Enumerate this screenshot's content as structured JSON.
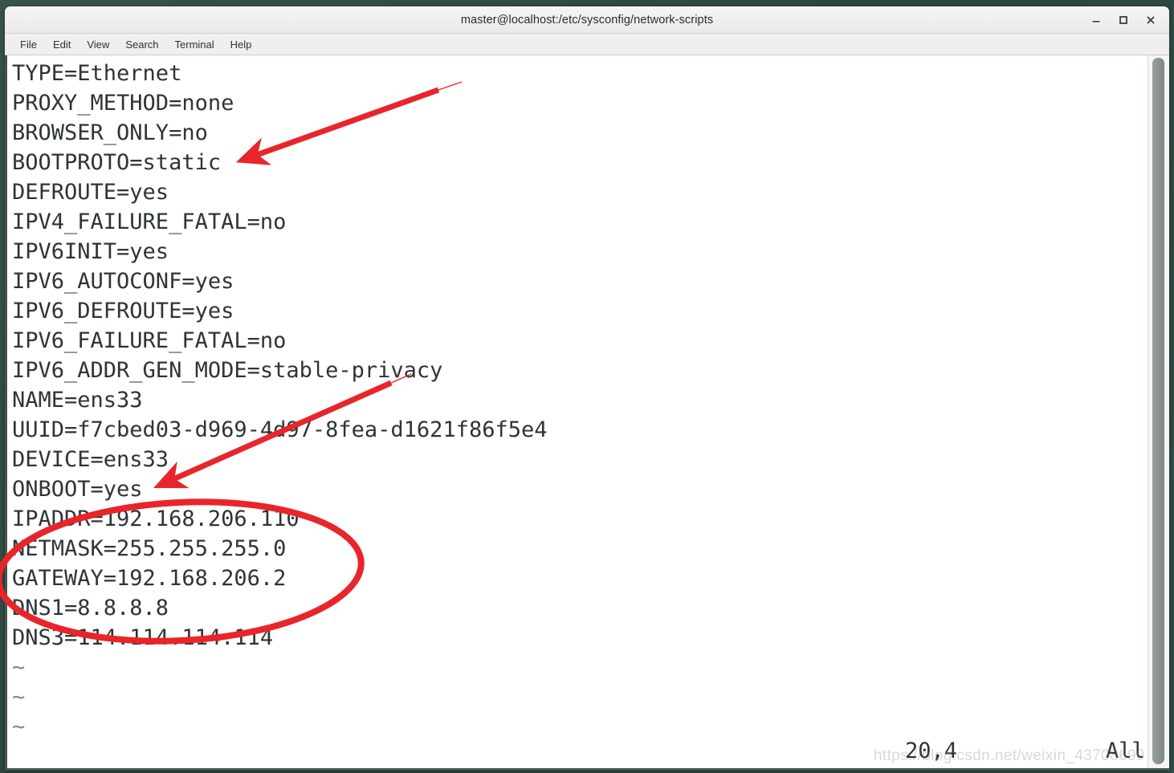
{
  "window": {
    "title": "master@localhost:/etc/sysconfig/network-scripts",
    "controls": {
      "minimize": "–",
      "maximize": "□",
      "close": "✕"
    }
  },
  "menubar": {
    "items": [
      {
        "label": "File"
      },
      {
        "label": "Edit"
      },
      {
        "label": "View"
      },
      {
        "label": "Search"
      },
      {
        "label": "Terminal"
      },
      {
        "label": "Help"
      }
    ]
  },
  "editor": {
    "lines": [
      "TYPE=Ethernet",
      "PROXY_METHOD=none",
      "BROWSER_ONLY=no",
      "BOOTPROTO=static",
      "DEFROUTE=yes",
      "IPV4_FAILURE_FATAL=no",
      "IPV6INIT=yes",
      "IPV6_AUTOCONF=yes",
      "IPV6_DEFROUTE=yes",
      "IPV6_FAILURE_FATAL=no",
      "IPV6_ADDR_GEN_MODE=stable-privacy",
      "NAME=ens33",
      "UUID=f7cbed03-d969-4d97-8fea-d1621f86f5e4",
      "DEVICE=ens33",
      "ONBOOT=yes",
      "IPADDR=192.168.206.110",
      "NETMASK=255.255.255.0",
      "GATEWAY=192.168.206.2",
      "DNS1=8.8.8.8",
      "DNS3=114.114.114.114"
    ],
    "empty_markers": [
      "~",
      "~",
      "~"
    ],
    "status": {
      "position": "20,4",
      "scroll": "All"
    }
  },
  "annotations": {
    "color": "#e8252a",
    "arrows": [
      {
        "name": "arrow-to-bootproto",
        "target_line": "BOOTPROTO=static"
      },
      {
        "name": "arrow-to-onboot",
        "target_line": "ONBOOT=yes"
      }
    ],
    "ellipse": {
      "name": "ellipse-ip-settings",
      "encloses": [
        "IPADDR=192.168.206.110",
        "NETMASK=255.255.255.0",
        "GATEWAY=192.168.206.2",
        "DNS1=8.8.8.8",
        "DNS3=114.114.114.114"
      ]
    }
  },
  "watermark": {
    "text": "https://blog.csdn.net/weixin_43708699"
  },
  "colors": {
    "desktop": "#2e4a44",
    "titlebar": "#f0eeec",
    "terminal_bg": "#ffffff",
    "terminal_fg": "#2e3436",
    "tilde": "#7289a3",
    "annotation_red": "#e8252a",
    "scrollbar": "#8b9393"
  }
}
